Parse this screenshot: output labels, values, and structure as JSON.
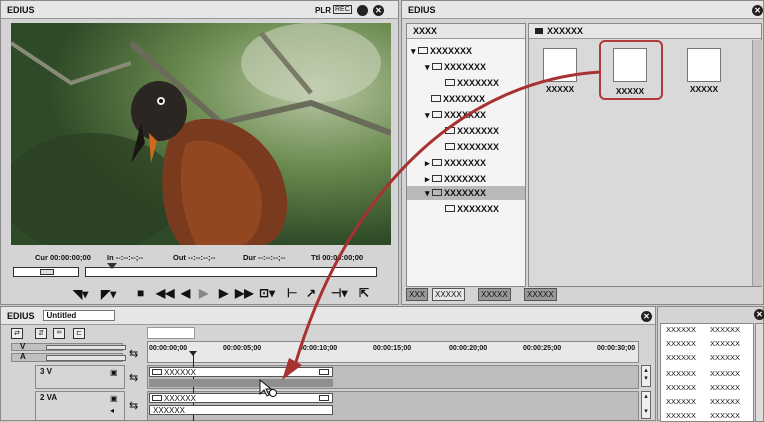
{
  "player": {
    "title": "EDIUS",
    "plr": "PLR",
    "rec": "REC",
    "cur_label": "Cur 00:00:00;00",
    "in_label": "In --:--:--;--",
    "out_label": "Out --:--:--;--",
    "dur_label": "Dur --:--:--;--",
    "ttl_label": "Ttl 00:00:00;00"
  },
  "bin": {
    "title": "EDIUS",
    "tree_header": "XXXX",
    "content_header": "XXXXXX",
    "tree": [
      "XXXXXXX",
      "XXXXXXX",
      "XXXXXXX",
      "XXXXXXX",
      "XXXXXXX",
      "XXXXXXX",
      "XXXXXXX",
      "XXXXXXX",
      "XXXXXXX",
      "XXXXXXX",
      "XXXXXXX"
    ],
    "thumbs": [
      "XXXXX",
      "XXXXX",
      "XXXXX"
    ],
    "tabs": [
      "XXX",
      "XXXXX",
      "XXXXX",
      "XXXXX"
    ]
  },
  "timeline": {
    "title": "EDIUS",
    "sequence": "Untitled",
    "ruler": [
      "00:00:00;00",
      "00:00:05;00",
      "00:00:10;00",
      "00:00:15;00",
      "00:00:20;00",
      "00:00:25;00",
      "00:00:30;00"
    ],
    "tracks": [
      {
        "name": "V",
        "type": "V"
      },
      {
        "name": "A",
        "type": "A"
      },
      {
        "name": "3 V",
        "type": "V"
      },
      {
        "name": "2 VA",
        "type": "VA"
      }
    ],
    "clips": {
      "v3": "XXXXXX",
      "va2_top": "XXXXXX",
      "va2_bottom": "XXXXXX"
    }
  },
  "side_bin": {
    "rows": [
      [
        "XXXXXX",
        "XXXXXX"
      ],
      [
        "XXXXXX",
        "XXXXXX"
      ],
      [
        "XXXXXX",
        "XXXXXX"
      ],
      [
        "XXXXXX",
        "XXXXXX"
      ],
      [
        "XXXXXX",
        "XXXXXX"
      ],
      [
        "XXXXXX",
        "XXXXXX"
      ],
      [
        "XXXXXX",
        "XXXXXX"
      ]
    ]
  },
  "colors": {
    "highlight": "#b03a3a",
    "arrow": "#a83232"
  }
}
